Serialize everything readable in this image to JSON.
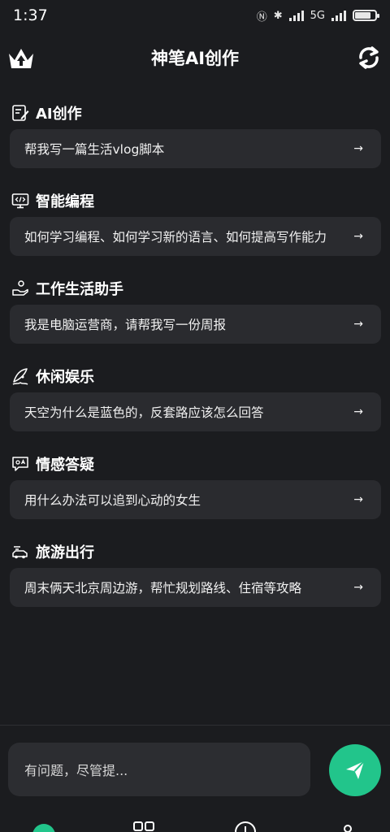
{
  "status_bar": {
    "time": "1:37",
    "network": "5G"
  },
  "header": {
    "title": "神笔AI创作"
  },
  "sections": [
    {
      "title": "AI创作",
      "prompt": "帮我写一篇生活vlog脚本",
      "icon": "edit-doc-icon"
    },
    {
      "title": "智能编程",
      "prompt": "如何学习编程、如何学习新的语言、如何提高写作能力",
      "icon": "code-monitor-icon"
    },
    {
      "title": "工作生活助手",
      "prompt": "我是电脑运营商，请帮我写一份周报",
      "icon": "hand-helper-icon"
    },
    {
      "title": "休闲娱乐",
      "prompt": "天空为什么是蓝色的，反套路应该怎么回答",
      "icon": "surf-icon"
    },
    {
      "title": "情感答疑",
      "prompt": "用什么办法可以追到心动的女生",
      "icon": "qa-chat-icon"
    },
    {
      "title": "旅游出行",
      "prompt": "周末俩天北京周边游，帮忙规划路线、住宿等攻略",
      "icon": "travel-car-icon"
    }
  ],
  "arrow": "→",
  "input": {
    "placeholder": "有问题，尽管提..."
  },
  "colors": {
    "accent": "#22c58b",
    "background": "#1b1c1f",
    "card": "#2a2b2f"
  }
}
